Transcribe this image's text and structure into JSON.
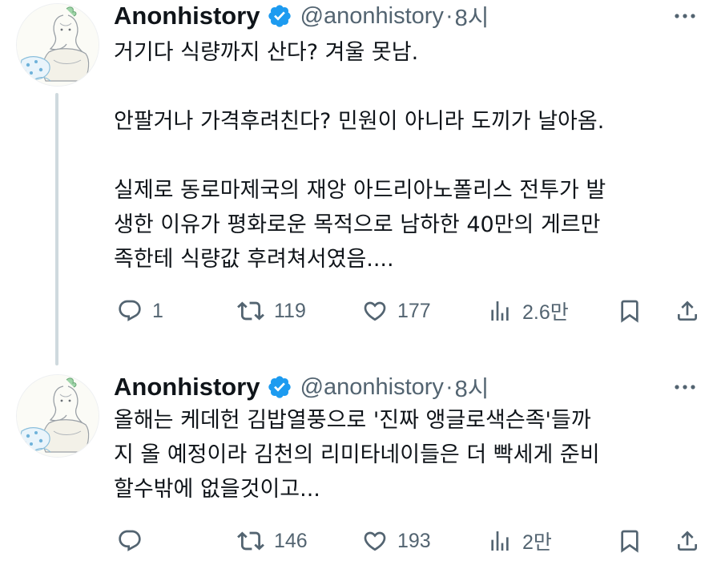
{
  "colors": {
    "text_primary": "#0f1419",
    "text_secondary": "#536471",
    "verified_badge": "#1d9bf0",
    "thread_line": "#cfd9de"
  },
  "tweets": [
    {
      "author_name": "Anonhistory",
      "handle": "@anonhistory",
      "separator": "·",
      "time": "8시",
      "lines": [
        "거기다 식량까지 산다? 겨울 못남.",
        "",
        "안팔거나 가격후려친다? 민원이 아니라 도끼가 날아옴.",
        "",
        "실제로 동로마제국의 재앙 아드리아노폴리스 전투가 발",
        "생한 이유가 평화로운 목적으로 남하한 40만의 게르만",
        "족한테 식량값 후려쳐서였음...."
      ],
      "replies": "1",
      "retweets": "119",
      "likes": "177",
      "views": "2.6만",
      "icons": [
        "verified-icon",
        "more-icon",
        "reply-icon",
        "retweet-icon",
        "like-icon",
        "views-icon",
        "bookmark-icon",
        "share-icon"
      ]
    },
    {
      "author_name": "Anonhistory",
      "handle": "@anonhistory",
      "separator": "·",
      "time": "8시",
      "lines": [
        "올해는 케데헌 김밥열풍으로 '진짜 앵글로색슨족'들까",
        "지 올 예정이라 김천의 리미타네이들은 더 빡세게 준비",
        "할수밖에 없을것이고..."
      ],
      "replies": "",
      "retweets": "146",
      "likes": "193",
      "views": "2만",
      "icons": [
        "verified-icon",
        "more-icon",
        "reply-icon",
        "retweet-icon",
        "like-icon",
        "views-icon",
        "bookmark-icon",
        "share-icon"
      ]
    }
  ]
}
